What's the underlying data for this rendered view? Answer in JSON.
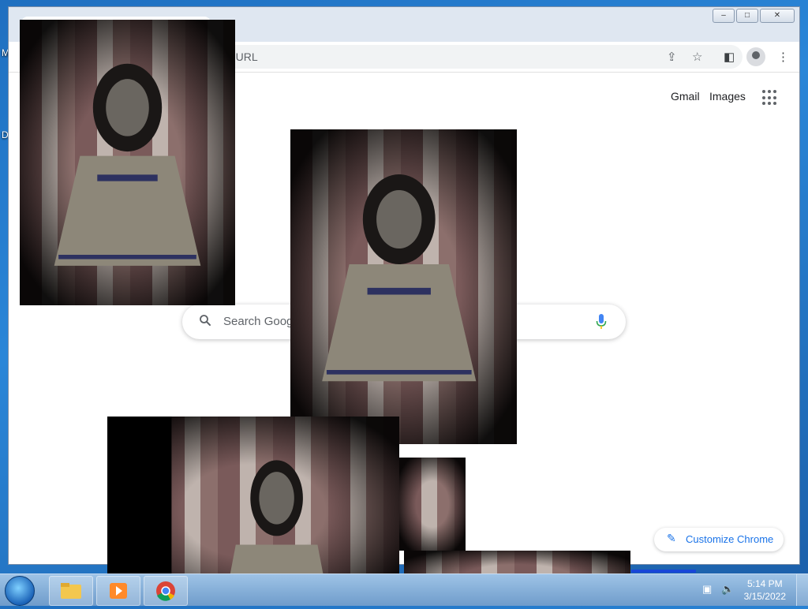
{
  "desktop": {
    "icon_label_1": "M",
    "icon_label_2": "D"
  },
  "browser": {
    "address_placeholder": "a URL",
    "top_links": {
      "gmail": "Gmail",
      "images": "Images"
    },
    "search_placeholder": "Search Goog",
    "customize_label": "Customize Chrome"
  },
  "window_controls": {
    "minimize": "–",
    "maximize": "□",
    "close": "✕"
  },
  "taskbar": {
    "time": "5:14 PM",
    "date": "3/15/2022"
  },
  "icons": [
    "share-icon",
    "star-icon",
    "side-panel-icon",
    "profile-avatar",
    "menu-dots-icon",
    "search-icon",
    "mic-icon",
    "pencil-icon",
    "apps-icon"
  ],
  "colors": {
    "accent": "#1a73e8",
    "taskbar": "#6f9ccb"
  }
}
